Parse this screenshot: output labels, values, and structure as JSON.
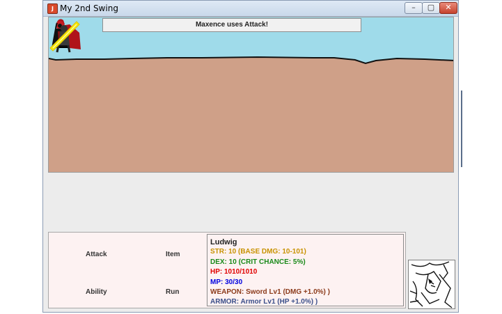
{
  "window": {
    "title": "My 2nd Swing"
  },
  "battle": {
    "message": "Maxence uses Attack!",
    "colors": {
      "sky": "#9fdbea",
      "ground": "#cfa088",
      "horizon": "#111111"
    }
  },
  "commands": {
    "attack": "Attack",
    "item": "Item",
    "ability": "Ability",
    "run": "Run"
  },
  "character": {
    "name": "Ludwig",
    "str": "STR: 10 (BASE DMG: 10-101)",
    "dex": "DEX: 10 (CRIT CHANCE: 5%)",
    "hp": "HP: 1010/1010",
    "mp": "MP: 30/30",
    "weapon": "WEAPON: Sword Lv1 (DMG +1.0%) )",
    "armor": "ARMOR: Armor Lv1 (HP +1.0%) )",
    "colors": {
      "str": "#c89200",
      "dex": "#1a8a1a",
      "hp": "#e00000",
      "mp": "#0000e0",
      "weapon": "#8b3a1a",
      "armor": "#3a4f8a"
    }
  }
}
